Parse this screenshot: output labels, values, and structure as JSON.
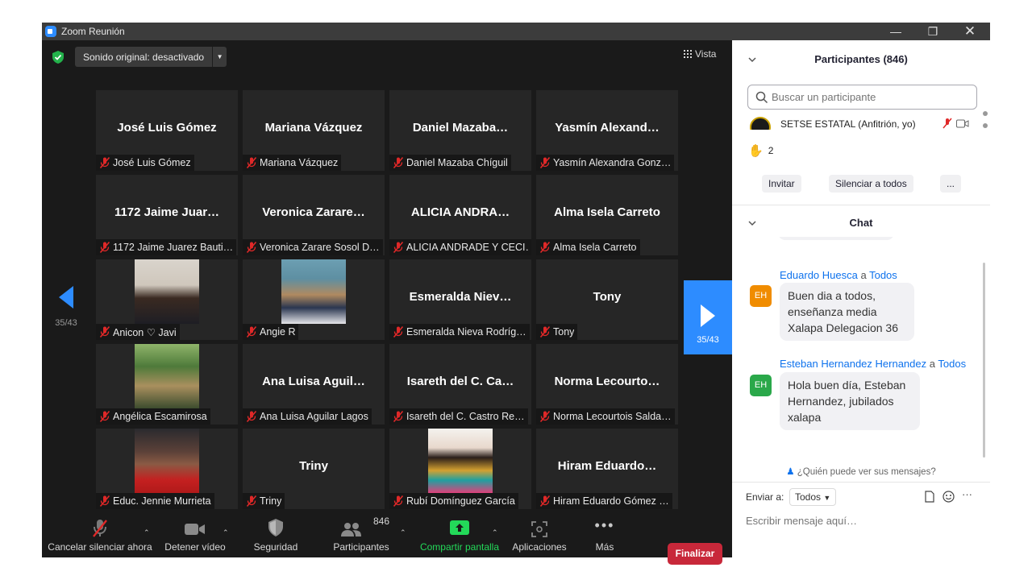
{
  "window": {
    "title": "Zoom Reunión"
  },
  "top_bar": {
    "sound_button": "Sonido original: desactivado",
    "view_button": "Vista"
  },
  "pagination": {
    "prev_label": "35/43",
    "next_label": "35/43"
  },
  "tiles": [
    {
      "big": "José Luis Gómez",
      "label": "José Luis Gómez"
    },
    {
      "big": "Mariana Vázquez",
      "label": "Mariana Vázquez"
    },
    {
      "big": "Daniel  Mazaba…",
      "label": "Daniel Mazaba Chíguil"
    },
    {
      "big": "Yasmín  Alexand…",
      "label": "Yasmín Alexandra Gonz…"
    },
    {
      "big": "1172 Jaime Juar…",
      "label": "1172 Jaime Juarez Bauti…"
    },
    {
      "big": "Veronica  Zarare…",
      "label": "Veronica Zarare Sosol D…"
    },
    {
      "big": "ALICIA  ANDRA…",
      "label": "ALICIA ANDRADE Y CECI…"
    },
    {
      "big": "Alma Isela Carreto",
      "label": "Alma Isela Carreto"
    },
    {
      "big": "",
      "label": "Anicon ♡ Javi",
      "photo": "woman-smiling-office"
    },
    {
      "big": "",
      "label": "Angie R",
      "photo": "woman-sunglasses-sea"
    },
    {
      "big": "Esmeralda  Niev…",
      "label": "Esmeralda Nieva Rodríg…"
    },
    {
      "big": "Tony",
      "label": "Tony"
    },
    {
      "big": "",
      "label": "Angélica Escamirosa",
      "photo": "park-dogs"
    },
    {
      "big": "Ana Luisa  Aguil…",
      "label": "Ana Luisa Aguilar Lagos"
    },
    {
      "big": "Isareth del C.  Ca…",
      "label": "Isareth del C. Castro Re…"
    },
    {
      "big": "Norma  Lecourto…",
      "label": "Norma Lecourtois Salda…"
    },
    {
      "big": "",
      "label": "Educ. Jennie Murrieta",
      "photo": "woman-red-shirt"
    },
    {
      "big": "Triny",
      "label": "Triny"
    },
    {
      "big": "",
      "label": "Rubí Domínguez García",
      "photo": "woman-colorful-dress"
    },
    {
      "big": "Hiram  Eduardo…",
      "label": "Hiram Eduardo Gómez …"
    }
  ],
  "toolbar": {
    "unmute": "Cancelar silenciar ahora",
    "video": "Detener vídeo",
    "security": "Seguridad",
    "participants": "Participantes",
    "participants_count": "846",
    "share": "Compartir pantalla",
    "apps": "Aplicaciones",
    "more": "Más",
    "end": "Finalizar"
  },
  "participants_panel": {
    "title": "Participantes (846)",
    "search_placeholder": "Buscar un participante",
    "host_row": "SETSE ESTATAL (Anfitrión, yo)",
    "raised_hands": "2",
    "invite": "Invitar",
    "mute_all": "Silenciar a todos",
    "more": "..."
  },
  "chat": {
    "title": "Chat",
    "messages": [
      {
        "sender": "Eduardo Huesca",
        "to_word": "a",
        "to": "Todos",
        "initials": "EH",
        "text": "Buen dia a todos, enseñanza media Xalapa Delegacion 36"
      },
      {
        "sender": "Esteban Hernandez Hernandez",
        "to_word": "a",
        "to": "Todos",
        "initials": "EH",
        "text": "Hola buen día, Esteban Hernandez, jubilados xalapa"
      }
    ],
    "who_can_see": "¿Quién puede ver sus mensajes?",
    "send_to_label": "Enviar a:",
    "send_to_value": "Todos",
    "input_placeholder": "Escribir mensaje aquí…"
  },
  "colors": {
    "accent": "#2d8cff",
    "end_button": "#c8283a",
    "share_green": "#23d959",
    "avatar_orange": "#f08c00",
    "avatar_green": "#2aa84a",
    "mic_red": "#e02828"
  }
}
